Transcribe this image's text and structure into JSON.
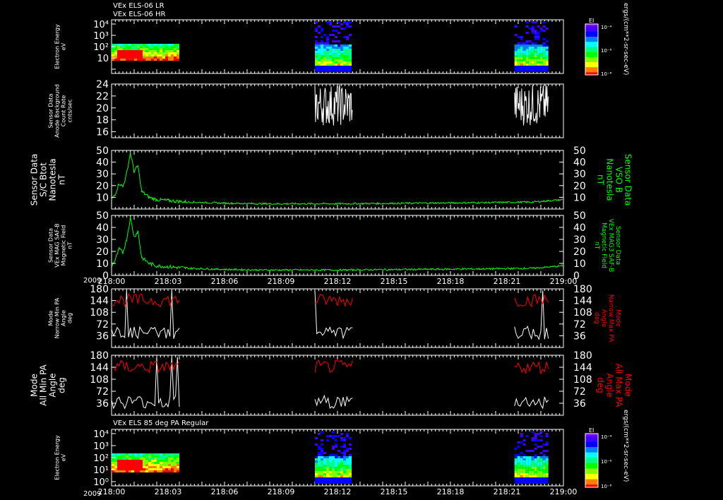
{
  "titles": {
    "top_line1": "VEx ELS-06 LR",
    "top_line2": "VEx ELS-06 HR",
    "bottom": "VEx ELS 85 deg PA Regular"
  },
  "colorbar": {
    "label": "EI",
    "units": "ergs/(cm**2-sr-sec-eV)",
    "ticks": [
      "10⁻⁴",
      "10⁻⁶",
      "10⁻⁸"
    ],
    "colors": [
      "#ff0000",
      "#ff8000",
      "#ffff00",
      "#00ff00",
      "#00ffff",
      "#0000ff",
      "#8000ff"
    ]
  },
  "colors": {
    "white": "#ffffff",
    "green": "#00ff00",
    "red": "#ff0000",
    "background": "#000000"
  },
  "xaxis": {
    "year": "2009",
    "ticks": [
      "218:00",
      "218:03",
      "218:06",
      "218:09",
      "218:12",
      "218:15",
      "218:18",
      "218:21",
      "219:00"
    ],
    "range": [
      0,
      60
    ]
  },
  "chart_data": [
    {
      "type": "heatmap",
      "ylabel": [
        "Electron Energy",
        "eV"
      ],
      "yscale": "log",
      "ylim": [
        1,
        10000
      ],
      "yticks": [
        "10⁴",
        "10³",
        "10²",
        "10",
        ""
      ],
      "data_blocks_minutes": [
        [
          0,
          9
        ],
        [
          27,
          32
        ],
        [
          53.5,
          58
        ]
      ]
    },
    {
      "type": "line",
      "ylabel": [
        "Sensor Data",
        "Anode Background",
        "Count Rate",
        "cnts/sec"
      ],
      "ylim": [
        15,
        24
      ],
      "yticks": [
        16,
        18,
        20,
        22,
        24
      ],
      "series": [
        {
          "color": "white",
          "x_range": [
            27,
            32
          ]
        },
        {
          "color": "white",
          "x_range": [
            53.5,
            58
          ]
        }
      ]
    },
    {
      "type": "line",
      "ylabel": [
        "Sensor Data",
        "S/C Btot",
        "Nanotesla",
        "nT"
      ],
      "ylabel_right": [
        "Sensor Data",
        "VSO B",
        "Nanotesla",
        "nT"
      ],
      "ylim": [
        0,
        50
      ],
      "yticks": [
        10,
        20,
        30,
        40,
        50
      ],
      "x": [
        0,
        0.5,
        1,
        1.5,
        2,
        2.5,
        3,
        3.5,
        4,
        5,
        6,
        8,
        10,
        15,
        20,
        30,
        40,
        50,
        56,
        60
      ],
      "y": [
        8,
        13,
        22,
        19,
        30,
        48,
        32,
        37,
        15,
        10,
        8,
        7,
        6,
        5,
        4.5,
        4.5,
        5,
        5.5,
        6,
        8
      ]
    },
    {
      "type": "line",
      "ylabel": [
        "Sensor Data",
        "VEx MAG SAF-B",
        "Magnetic Field",
        "nT"
      ],
      "ylabel_right": [
        "Sensor Data",
        "VEx MAG3 SAF-B",
        "Magnetic Field",
        "nT"
      ],
      "ylim": [
        0,
        50
      ],
      "yticks": [
        0,
        10,
        20,
        30,
        40,
        50
      ],
      "x": [
        0,
        0.5,
        1,
        1.5,
        2,
        2.5,
        3,
        3.5,
        4,
        5,
        6,
        8,
        10,
        15,
        20,
        30,
        40,
        50,
        56,
        60
      ],
      "y": [
        8,
        13,
        22,
        19,
        30,
        48,
        32,
        37,
        15,
        10,
        8,
        7,
        6,
        5,
        4.5,
        4.5,
        5,
        5.5,
        6,
        8
      ]
    },
    {
      "type": "line",
      "ylabel": [
        "Mode",
        "Narrow Min PA",
        "Angle",
        "deg"
      ],
      "ylabel_right": [
        "Mode",
        "Narrow Max PA",
        "Angle",
        "deg"
      ],
      "ylim": [
        0,
        180
      ],
      "yticks": [
        36,
        72,
        108,
        144,
        180
      ],
      "series": [
        {
          "name": "Min PA",
          "color": "white",
          "x_range_blocks": [
            [
              0,
              9
            ],
            [
              27,
              32
            ],
            [
              53.5,
              58
            ]
          ],
          "level": 45
        },
        {
          "name": "Max PA",
          "color": "red",
          "x_range_blocks": [
            [
              0,
              9
            ],
            [
              27,
              32
            ],
            [
              53.5,
              58
            ]
          ],
          "level": 145
        }
      ]
    },
    {
      "type": "line",
      "ylabel": [
        "Mode",
        "All Min PA",
        "Angle",
        "deg"
      ],
      "ylabel_right": [
        "Mode",
        "All Max PA",
        "Angle",
        "deg"
      ],
      "ylim": [
        0,
        180
      ],
      "yticks": [
        36,
        72,
        108,
        144,
        180
      ],
      "series": [
        {
          "name": "Min PA",
          "color": "white",
          "x_range_blocks": [
            [
              0,
              9
            ],
            [
              27,
              32
            ],
            [
              53.5,
              58
            ]
          ],
          "level": 40
        },
        {
          "name": "Max PA",
          "color": "red",
          "x_range_blocks": [
            [
              0,
              9
            ],
            [
              27,
              32
            ],
            [
              53.5,
              58
            ]
          ],
          "level": 145
        }
      ]
    },
    {
      "type": "heatmap",
      "ylabel": [
        "Electron Energy",
        "eV"
      ],
      "yscale": "log",
      "ylim": [
        1,
        10000
      ],
      "yticks": [
        "10⁴",
        "10³",
        "10²",
        "10¹",
        "10⁰"
      ],
      "data_blocks_minutes": [
        [
          0,
          9
        ],
        [
          27,
          32
        ],
        [
          53.5,
          58
        ]
      ]
    }
  ]
}
